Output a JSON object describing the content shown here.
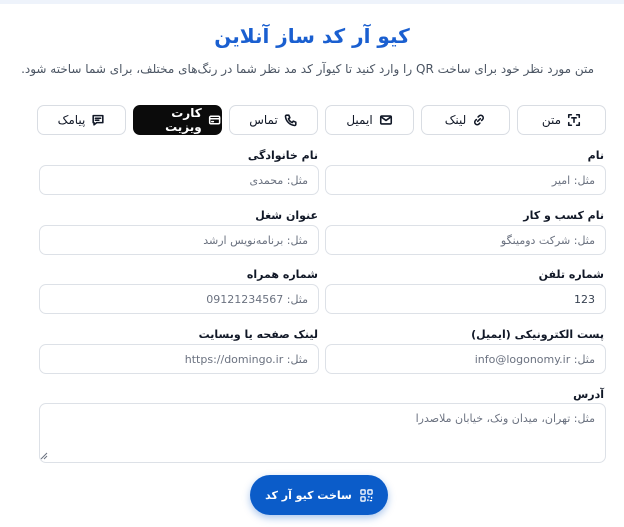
{
  "header": {
    "title": "کیو آر کد ساز آنلاین",
    "subtitle": "متن مورد نظر خود برای ساخت QR را وارد کنید تا کیوآر کد مد نظر شما در رنگ‌های مختلف، برای شما ساخته شود."
  },
  "tabs": [
    {
      "label": "متن",
      "icon": "text-scan-icon"
    },
    {
      "label": "لینک",
      "icon": "link-icon"
    },
    {
      "label": "ایمیل",
      "icon": "mail-icon"
    },
    {
      "label": "تماس",
      "icon": "phone-icon"
    },
    {
      "label": "کارت ویزیت",
      "icon": "card-icon",
      "active": true
    },
    {
      "label": "پیامک",
      "icon": "message-icon"
    }
  ],
  "form": {
    "first_name": {
      "label": "نام",
      "placeholder": "مثل: امیر",
      "value": ""
    },
    "last_name": {
      "label": "نام خانوادگی",
      "placeholder": "مثل: محمدی",
      "value": ""
    },
    "company": {
      "label": "نام کسب و کار",
      "placeholder": "مثل: شرکت دومینگو",
      "value": ""
    },
    "job_title": {
      "label": "عنوان شغل",
      "placeholder": "مثل: برنامه‌نویس ارشد",
      "value": ""
    },
    "phone": {
      "label": "شماره تلفن",
      "value": "123"
    },
    "mobile": {
      "label": "شماره همراه",
      "placeholder": "مثل: 09121234567",
      "value": ""
    },
    "email": {
      "label": "پست الکترونیکی (ایمیل)",
      "placeholder": "مثل: info@logonomy.ir",
      "value": ""
    },
    "website": {
      "label": "لینک صفحه یا وبسایت",
      "placeholder": "مثل: https://domingo.ir",
      "value": ""
    },
    "address": {
      "label": "آدرس",
      "placeholder": "مثل: تهران، میدان ونک، خیابان ملاصدرا",
      "value": ""
    }
  },
  "submit": {
    "label": "ساخت کیو آر کد",
    "icon": "qr-code-icon"
  },
  "colors": {
    "accent": "#1a5fd0",
    "button": "#0b5cc9",
    "active_tab": "#0b0b0b"
  }
}
